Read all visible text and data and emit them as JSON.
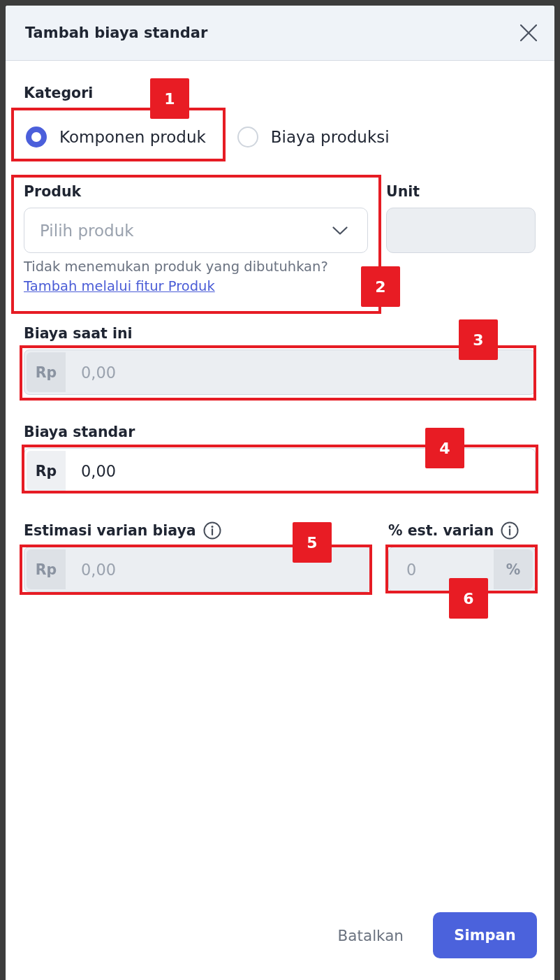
{
  "dialog": {
    "title": "Tambah biaya standar"
  },
  "category": {
    "label": "Kategori",
    "options": [
      {
        "label": "Komponen produk",
        "selected": true
      },
      {
        "label": "Biaya produksi",
        "selected": false
      }
    ]
  },
  "product": {
    "label": "Produk",
    "placeholder": "Pilih produk",
    "helper": "Tidak menemukan produk yang dibutuhkan?",
    "link": "Tambah melalui fitur Produk"
  },
  "unit": {
    "label": "Unit",
    "disabled": true
  },
  "current_cost": {
    "label": "Biaya saat ini",
    "prefix": "Rp",
    "value": "0,00",
    "disabled": true
  },
  "standard_cost": {
    "label": "Biaya standar",
    "prefix": "Rp",
    "value": "0,00",
    "disabled": false
  },
  "variance": {
    "label": "Estimasi varian biaya",
    "info": true,
    "prefix": "Rp",
    "value": "0,00",
    "disabled": true
  },
  "variance_percent": {
    "label": "% est. varian",
    "info": true,
    "suffix": "%",
    "value": "0",
    "disabled": true
  },
  "buttons": [
    {
      "label": "Batalkan",
      "kind": "secondary"
    },
    {
      "label": "Simpan",
      "kind": "primary"
    }
  ],
  "annotations": [
    {
      "number": "1"
    },
    {
      "number": "2"
    },
    {
      "number": "3"
    },
    {
      "number": "4"
    },
    {
      "number": "5"
    },
    {
      "number": "6"
    }
  ]
}
